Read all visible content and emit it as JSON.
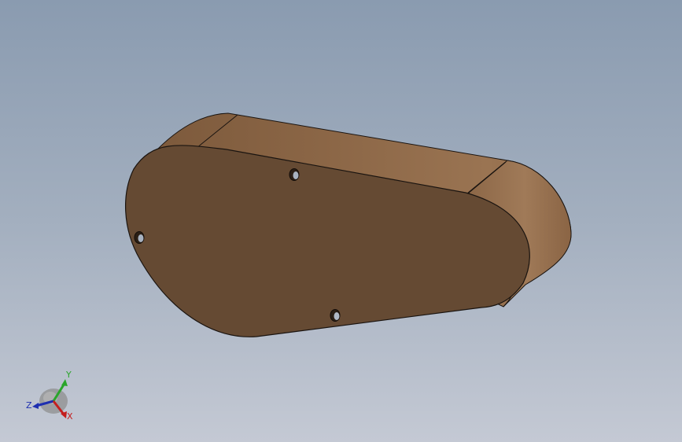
{
  "viewport": {
    "background_top": "#8a9bb0",
    "background_bottom": "#c4c9d4"
  },
  "part": {
    "face_color": "#654a33",
    "side_color": "#8b6646",
    "edge_color": "#1a1410",
    "hole_count": 3
  },
  "triad": {
    "x_label": "X",
    "y_label": "Y",
    "z_label": "Z",
    "x_color": "#c41e1e",
    "y_color": "#2aa52a",
    "z_color": "#1e2fb0"
  }
}
